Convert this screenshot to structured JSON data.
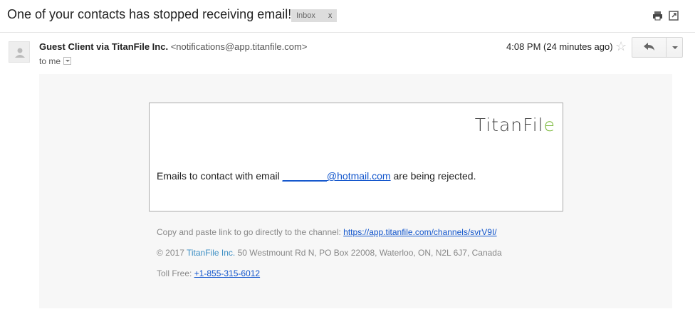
{
  "subject": {
    "text": "One of your contacts has stopped receiving email!",
    "label": "Inbox",
    "label_close": "x"
  },
  "toolbar": {
    "print_icon": "printer-icon",
    "popout_icon": "new-window-icon"
  },
  "message": {
    "sender_name": "Guest Client via TitanFile Inc.",
    "sender_email": "<notifications@app.titanfile.com>",
    "to_text": "to me",
    "time": "4:08 PM (24 minutes ago)"
  },
  "body": {
    "logo": "TitanFil",
    "logo_end": "e",
    "text_before": "Emails to contact with email ",
    "email_link": "________@hotmail.com",
    "text_after": " are being rejected.",
    "copy_label": "Copy and paste link to go directly to the channel: ",
    "channel_link": "https://app.titanfile.com/channels/svrV9I/",
    "copyright_prefix": "© 2017 ",
    "copyright_brand": "TitanFile Inc.",
    "copyright_address": " 50 Westmount Rd N, PO Box 22008, Waterloo, ON, N2L 6J7, Canada",
    "tollfree_label": "Toll Free: ",
    "tollfree_number": "+1-855-315-6012"
  },
  "colors": {
    "link": "#1155cc",
    "brand_accent": "#7ab83a",
    "body_background": "#f7f7f7"
  }
}
